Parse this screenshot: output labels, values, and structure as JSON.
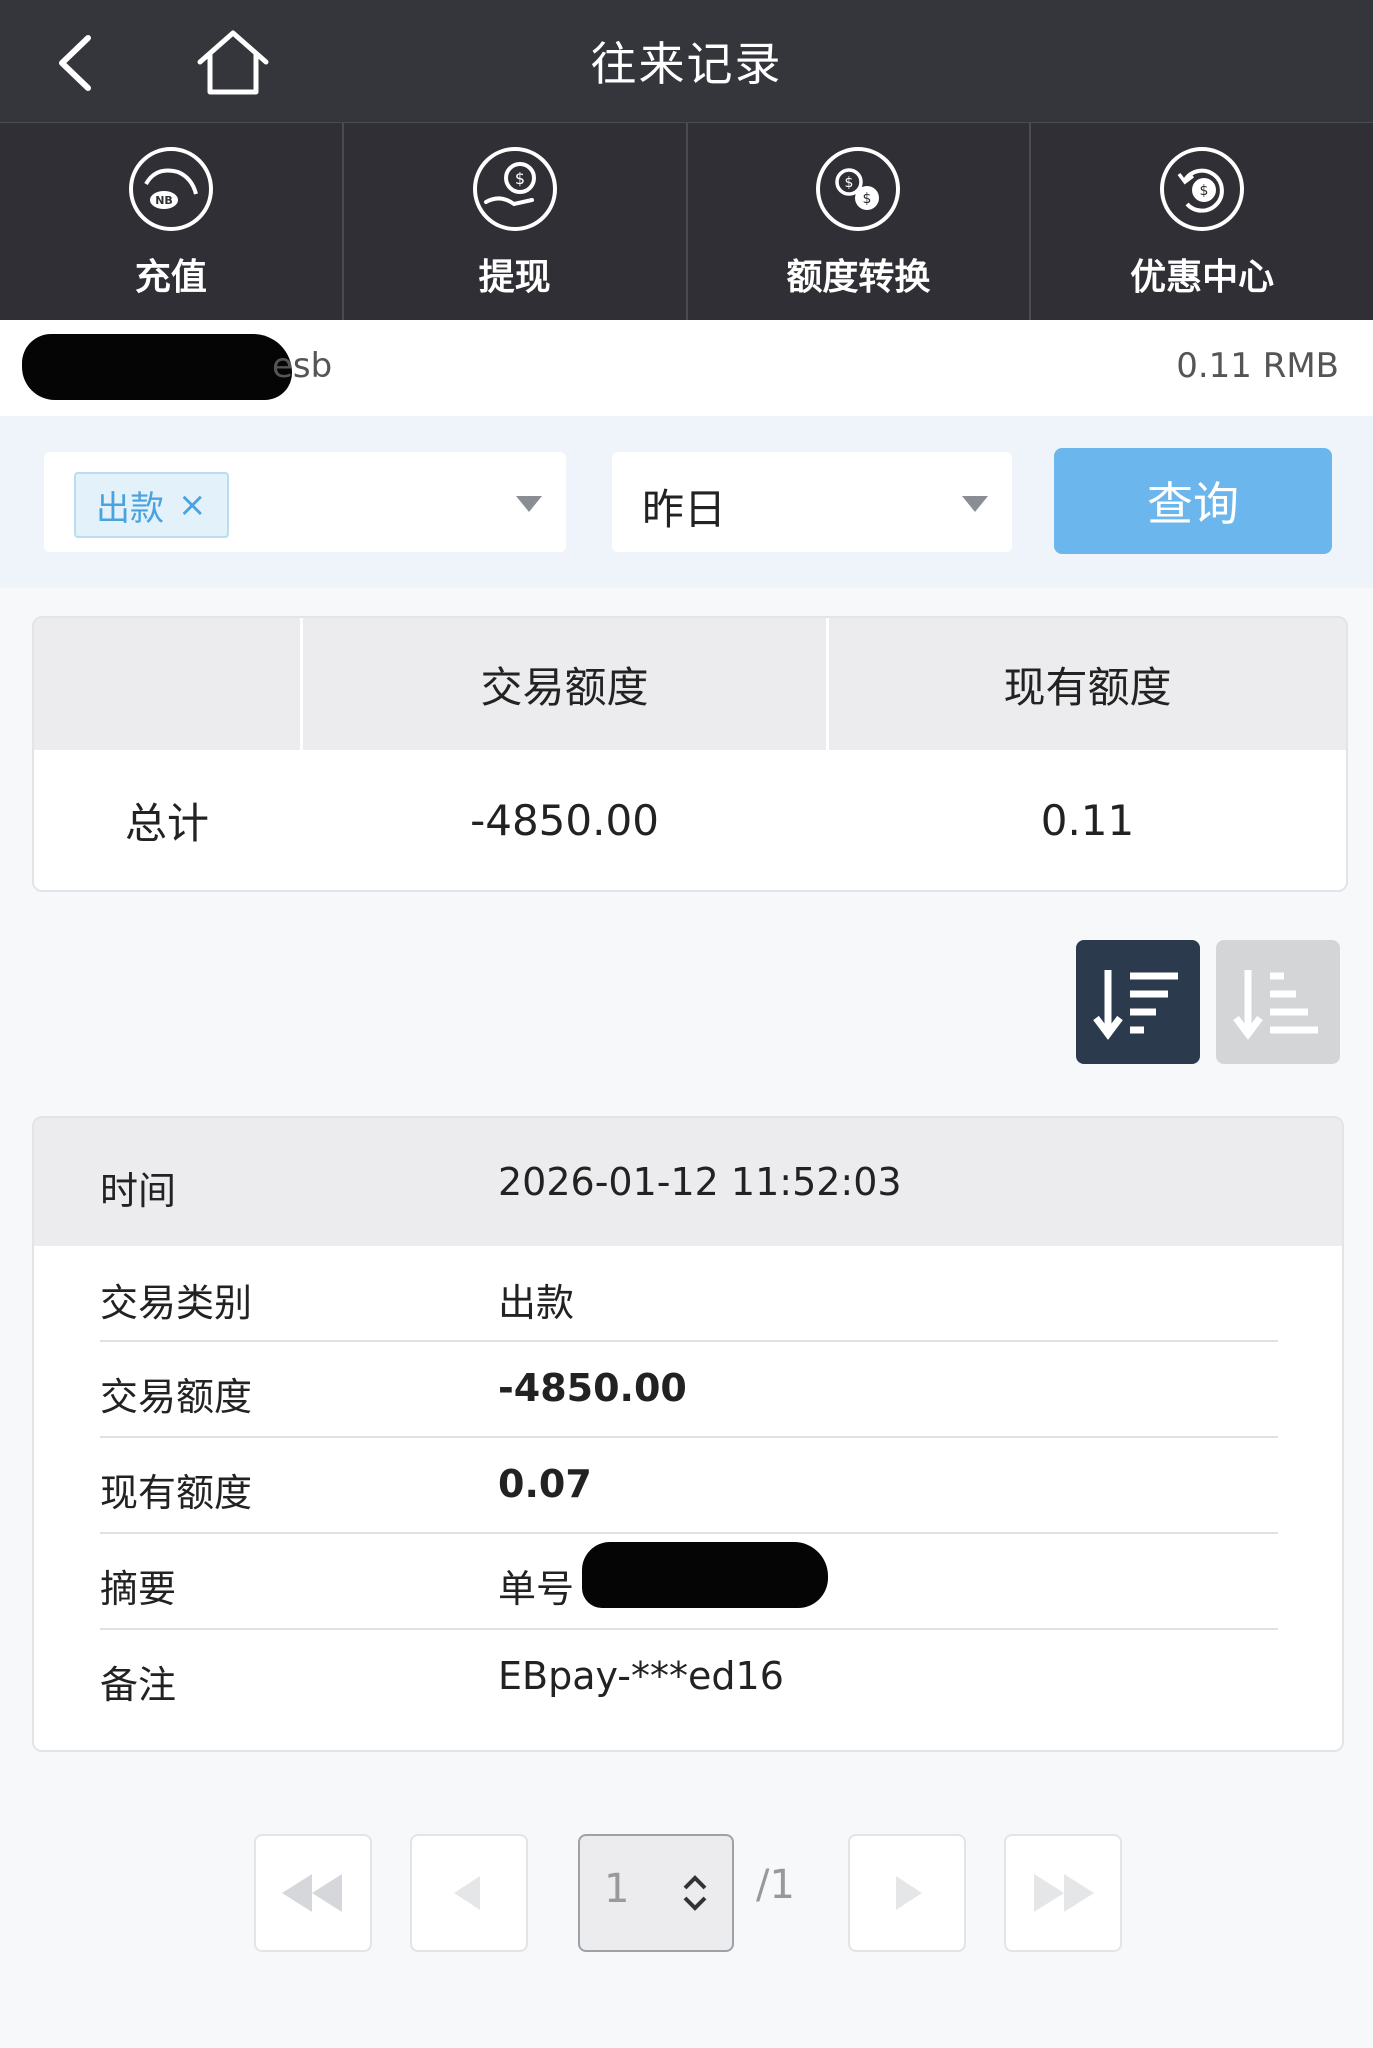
{
  "header": {
    "title": "往来记录"
  },
  "quick_nav": [
    {
      "label": "充值",
      "icon": "deposit-icon"
    },
    {
      "label": "提现",
      "icon": "withdraw-icon"
    },
    {
      "label": "额度转换",
      "icon": "transfer-icon"
    },
    {
      "label": "优惠中心",
      "icon": "promo-icon"
    }
  ],
  "account": {
    "name_suffix": "esb",
    "balance": "0.11 RMB"
  },
  "filter": {
    "type_tag": "出款",
    "tag_close": "×",
    "date_range": "昨日",
    "query_button": "查询"
  },
  "summary": {
    "headers": [
      "",
      "交易额度",
      "现有额度"
    ],
    "row_label": "总计",
    "trade_amount": "-4850.00",
    "current_amount": "0.11"
  },
  "record": {
    "time_label": "时间",
    "time_value": "2026-01-12 11:52:03",
    "rows": [
      {
        "label": "交易类别",
        "value": "出款",
        "bold": false
      },
      {
        "label": "交易额度",
        "value": "-4850.00",
        "bold": true
      },
      {
        "label": "现有额度",
        "value": "0.07",
        "bold": true
      },
      {
        "label": "摘要",
        "value": "单号",
        "bold": false
      },
      {
        "label": "备注",
        "value": "EBpay-***ed16",
        "bold": false
      }
    ]
  },
  "pagination": {
    "current_page": "1",
    "total_pages": "/1"
  },
  "colors": {
    "header_bg": "#35353c",
    "query_button": "#6cb6ee",
    "tag_text": "#4aa3df",
    "sort_active": "#2c3a4e"
  }
}
